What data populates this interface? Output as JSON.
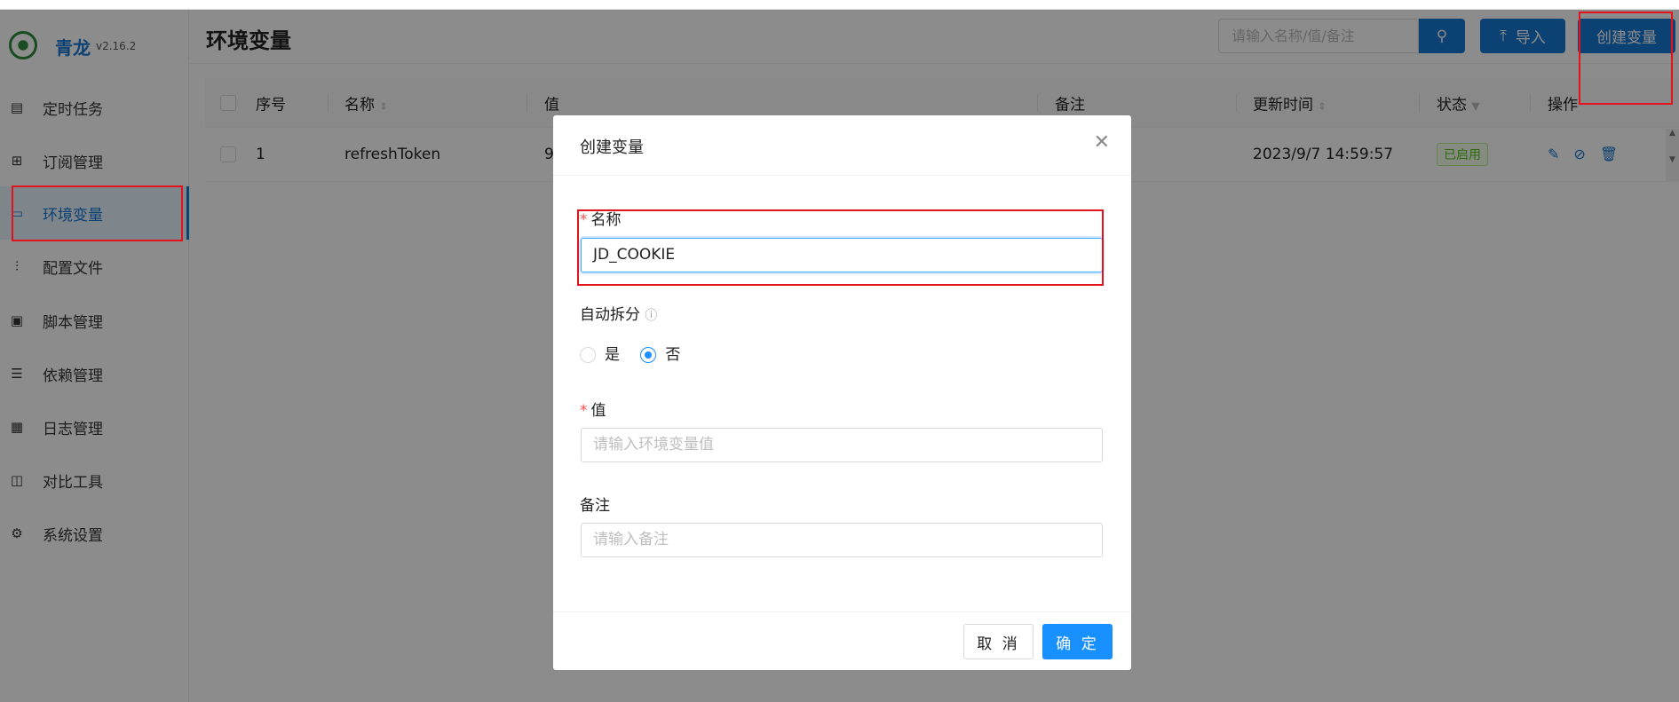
{
  "brand": {
    "name": "青龙",
    "version": "v2.16.2"
  },
  "sidebar": {
    "items": [
      {
        "label": "定时任务",
        "icon": "calendar-icon"
      },
      {
        "label": "订阅管理",
        "icon": "subscribe-icon"
      },
      {
        "label": "环境变量",
        "icon": "monitor-icon",
        "active": true
      },
      {
        "label": "配置文件",
        "icon": "sliders-icon"
      },
      {
        "label": "脚本管理",
        "icon": "terminal-icon"
      },
      {
        "label": "依赖管理",
        "icon": "list-circle-icon"
      },
      {
        "label": "日志管理",
        "icon": "log-icon"
      },
      {
        "label": "对比工具",
        "icon": "diff-icon"
      },
      {
        "label": "系统设置",
        "icon": "gear-icon"
      }
    ]
  },
  "header": {
    "title": "环境变量",
    "search_placeholder": "请输入名称/值/备注",
    "import_label": "导入",
    "create_label": "创建变量"
  },
  "table": {
    "columns": [
      "序号",
      "名称",
      "值",
      "备注",
      "更新时间",
      "状态",
      "操作"
    ],
    "rows": [
      {
        "index": "1",
        "name": "refreshToken",
        "value": "9",
        "remark": "",
        "updated": "2023/9/7 14:59:57",
        "status": "已启用"
      }
    ]
  },
  "modal": {
    "title": "创建变量",
    "name_label": "名称",
    "name_value": "JD_COOKIE",
    "split_label": "自动拆分",
    "split_options": [
      "是",
      "否"
    ],
    "split_selected": "否",
    "value_label": "值",
    "value_placeholder": "请输入环境变量值",
    "remark_label": "备注",
    "remark_placeholder": "请输入备注",
    "cancel_label": "取 消",
    "ok_label": "确 定"
  },
  "colors": {
    "primary": "#1677d2",
    "annotation": "#e3131c"
  }
}
